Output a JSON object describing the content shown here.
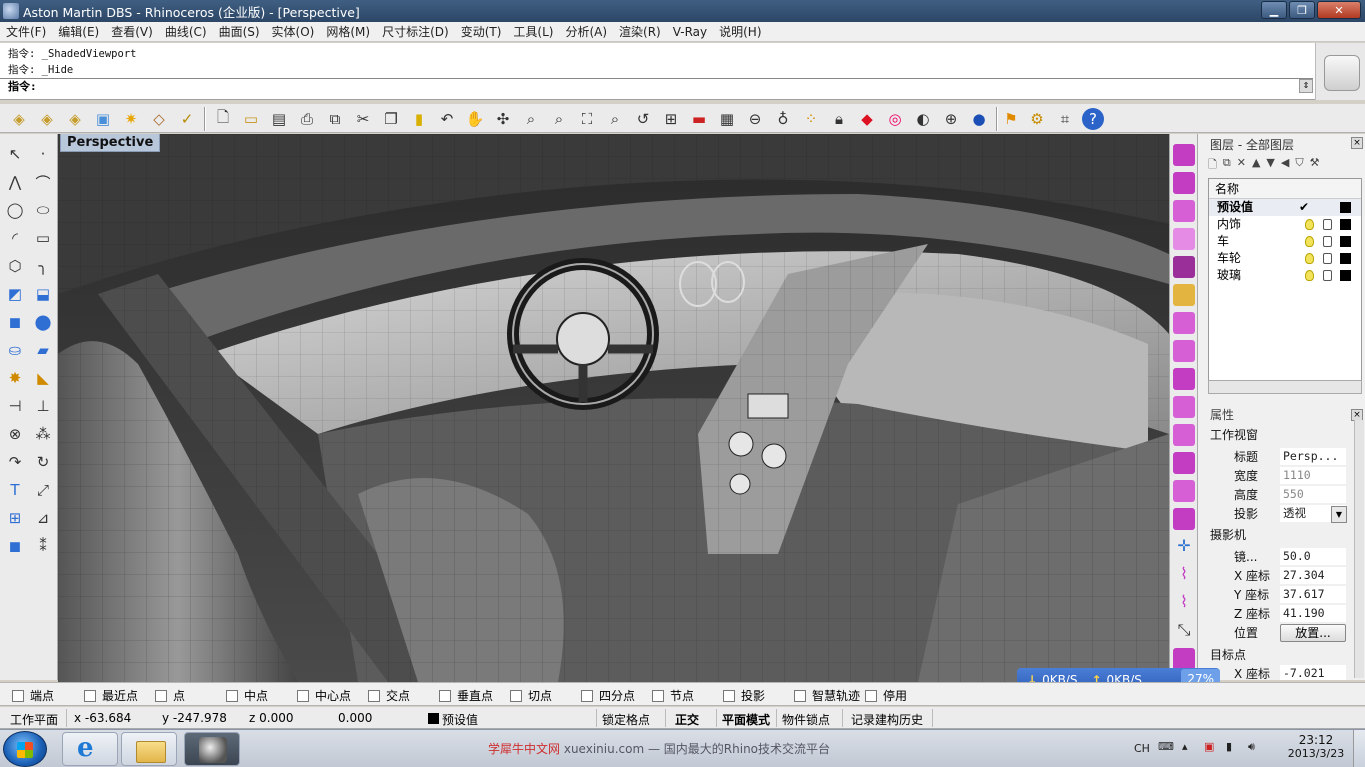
{
  "window": {
    "title": "Aston Martin DBS - Rhinoceros (企业版) - [Perspective]",
    "minimize": "▁",
    "maximize": "❐",
    "close": "✕"
  },
  "menu": [
    "文件(F)",
    "编辑(E)",
    "查看(V)",
    "曲线(C)",
    "曲面(S)",
    "实体(O)",
    "网格(M)",
    "尺寸标注(D)",
    "变动(T)",
    "工具(L)",
    "分析(A)",
    "渲染(R)",
    "V-Ray",
    "说明(H)"
  ],
  "command": {
    "history": [
      "指令: _ShadedViewport",
      "指令: _Hide"
    ],
    "prompt": "指令:"
  },
  "viewport": {
    "label": "Perspective"
  },
  "layers_panel": {
    "title": "图层 - 全部图层",
    "header": "名称",
    "layers": [
      {
        "name": "预设值",
        "current": true,
        "check": "✔",
        "color": "#000000"
      },
      {
        "name": "内饰",
        "current": false,
        "color": "#000000"
      },
      {
        "name": "车",
        "current": false,
        "color": "#000000"
      },
      {
        "name": "车轮",
        "current": false,
        "color": "#000000"
      },
      {
        "name": "玻璃",
        "current": false,
        "color": "#000000"
      }
    ]
  },
  "properties_panel": {
    "title": "属性",
    "section_viewport": "工作视窗",
    "title_label": "标题",
    "title_value": "Persp...",
    "width_label": "宽度",
    "width_value": "1110",
    "height_label": "高度",
    "height_value": "550",
    "projection_label": "投影",
    "projection_value": "透视",
    "section_camera": "摄影机",
    "lens_label": "镜...",
    "lens_value": "50.0",
    "cam_x_label": "X 座标",
    "cam_x_value": "27.304",
    "cam_y_label": "Y 座标",
    "cam_y_value": "37.617",
    "cam_z_label": "Z 座标",
    "cam_z_value": "41.190",
    "position_label": "位置",
    "place_button": "放置...",
    "section_target": "目标点",
    "target_x_label": "X 座标",
    "target_x_value": "-7.021"
  },
  "network": {
    "down": "0KB/S",
    "up": "0KB/S",
    "percent": "27%"
  },
  "osnaps": [
    "端点",
    "最近点",
    "点",
    "中点",
    "中心点",
    "交点",
    "垂直点",
    "切点",
    "四分点",
    "节点",
    "投影",
    "智慧轨迹",
    "停用"
  ],
  "status": {
    "cplane": "工作平面",
    "x": "x -63.684",
    "y": "y -247.978",
    "z": "z 0.000",
    "extra": "0.000",
    "layer": "预设值",
    "grid_snap": "锁定格点",
    "ortho": "正交",
    "planar": "平面模式",
    "osnap": "物件锁点",
    "history": "记录建构历史"
  },
  "taskbar": {
    "watermark_brand": "学犀牛中文网",
    "watermark_site": "xuexiniu.com",
    "watermark_text": "— 国内最大的Rhino技术交流平台",
    "ime": "CH",
    "time": "23:12",
    "date": "2013/3/23"
  }
}
